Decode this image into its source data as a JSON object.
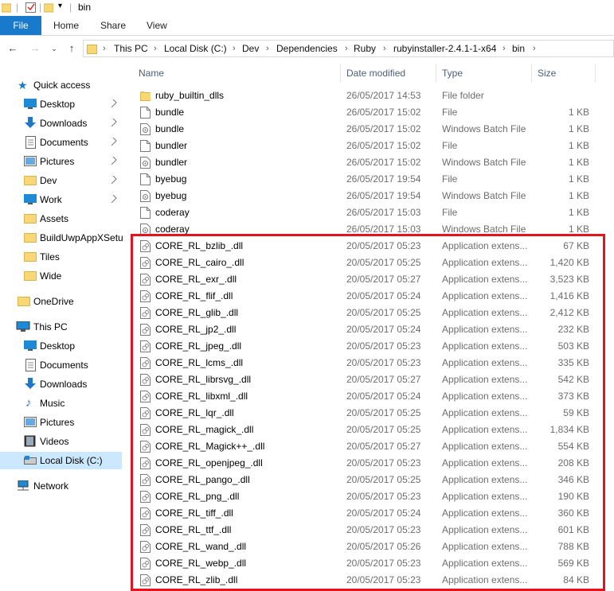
{
  "window": {
    "title": "bin"
  },
  "ribbon": {
    "tabs": [
      "File",
      "Home",
      "Share",
      "View"
    ]
  },
  "address": {
    "crumbs": [
      "This PC",
      "Local Disk (C:)",
      "Dev",
      "Dependencies",
      "Ruby",
      "rubyinstaller-2.4.1-1-x64",
      "bin"
    ]
  },
  "sidebar": {
    "quick_access": "Quick access",
    "quick_items": [
      "Desktop",
      "Downloads",
      "Documents",
      "Pictures",
      "Dev",
      "Work",
      "Assets",
      "BuildUwpAppXSetu",
      "Tiles",
      "Wide"
    ],
    "onedrive": "OneDrive",
    "this_pc": "This PC",
    "pc_items": [
      "Desktop",
      "Documents",
      "Downloads",
      "Music",
      "Pictures",
      "Videos",
      "Local Disk (C:)"
    ],
    "network": "Network"
  },
  "columns": {
    "name": "Name",
    "date": "Date modified",
    "type": "Type",
    "size": "Size"
  },
  "files": [
    {
      "name": "ruby_builtin_dlls",
      "date": "26/05/2017 14:53",
      "type": "File folder",
      "size": "",
      "icon": "folder-icon"
    },
    {
      "name": "bundle",
      "date": "26/05/2017 15:02",
      "type": "File",
      "size": "1 KB",
      "icon": "file-icon"
    },
    {
      "name": "bundle",
      "date": "26/05/2017 15:02",
      "type": "Windows Batch File",
      "size": "1 KB",
      "icon": "batch-file-icon"
    },
    {
      "name": "bundler",
      "date": "26/05/2017 15:02",
      "type": "File",
      "size": "1 KB",
      "icon": "file-icon"
    },
    {
      "name": "bundler",
      "date": "26/05/2017 15:02",
      "type": "Windows Batch File",
      "size": "1 KB",
      "icon": "batch-file-icon"
    },
    {
      "name": "byebug",
      "date": "26/05/2017 19:54",
      "type": "File",
      "size": "1 KB",
      "icon": "file-icon"
    },
    {
      "name": "byebug",
      "date": "26/05/2017 19:54",
      "type": "Windows Batch File",
      "size": "1 KB",
      "icon": "batch-file-icon"
    },
    {
      "name": "coderay",
      "date": "26/05/2017 15:03",
      "type": "File",
      "size": "1 KB",
      "icon": "file-icon"
    },
    {
      "name": "coderay",
      "date": "26/05/2017 15:03",
      "type": "Windows Batch File",
      "size": "1 KB",
      "icon": "batch-file-icon"
    },
    {
      "name": "CORE_RL_bzlib_.dll",
      "date": "20/05/2017 05:23",
      "type": "Application extens...",
      "size": "67 KB",
      "icon": "dll-icon"
    },
    {
      "name": "CORE_RL_cairo_.dll",
      "date": "20/05/2017 05:25",
      "type": "Application extens...",
      "size": "1,420 KB",
      "icon": "dll-icon"
    },
    {
      "name": "CORE_RL_exr_.dll",
      "date": "20/05/2017 05:27",
      "type": "Application extens...",
      "size": "3,523 KB",
      "icon": "dll-icon"
    },
    {
      "name": "CORE_RL_flif_.dll",
      "date": "20/05/2017 05:24",
      "type": "Application extens...",
      "size": "1,416 KB",
      "icon": "dll-icon"
    },
    {
      "name": "CORE_RL_glib_.dll",
      "date": "20/05/2017 05:25",
      "type": "Application extens...",
      "size": "2,412 KB",
      "icon": "dll-icon"
    },
    {
      "name": "CORE_RL_jp2_.dll",
      "date": "20/05/2017 05:24",
      "type": "Application extens...",
      "size": "232 KB",
      "icon": "dll-icon"
    },
    {
      "name": "CORE_RL_jpeg_.dll",
      "date": "20/05/2017 05:23",
      "type": "Application extens...",
      "size": "503 KB",
      "icon": "dll-icon"
    },
    {
      "name": "CORE_RL_lcms_.dll",
      "date": "20/05/2017 05:23",
      "type": "Application extens...",
      "size": "335 KB",
      "icon": "dll-icon"
    },
    {
      "name": "CORE_RL_librsvg_.dll",
      "date": "20/05/2017 05:27",
      "type": "Application extens...",
      "size": "542 KB",
      "icon": "dll-icon"
    },
    {
      "name": "CORE_RL_libxml_.dll",
      "date": "20/05/2017 05:24",
      "type": "Application extens...",
      "size": "373 KB",
      "icon": "dll-icon"
    },
    {
      "name": "CORE_RL_lqr_.dll",
      "date": "20/05/2017 05:25",
      "type": "Application extens...",
      "size": "59 KB",
      "icon": "dll-icon"
    },
    {
      "name": "CORE_RL_magick_.dll",
      "date": "20/05/2017 05:25",
      "type": "Application extens...",
      "size": "1,834 KB",
      "icon": "dll-icon"
    },
    {
      "name": "CORE_RL_Magick++_.dll",
      "date": "20/05/2017 05:27",
      "type": "Application extens...",
      "size": "554 KB",
      "icon": "dll-icon"
    },
    {
      "name": "CORE_RL_openjpeg_.dll",
      "date": "20/05/2017 05:23",
      "type": "Application extens...",
      "size": "208 KB",
      "icon": "dll-icon"
    },
    {
      "name": "CORE_RL_pango_.dll",
      "date": "20/05/2017 05:25",
      "type": "Application extens...",
      "size": "346 KB",
      "icon": "dll-icon"
    },
    {
      "name": "CORE_RL_png_.dll",
      "date": "20/05/2017 05:23",
      "type": "Application extens...",
      "size": "190 KB",
      "icon": "dll-icon"
    },
    {
      "name": "CORE_RL_tiff_.dll",
      "date": "20/05/2017 05:24",
      "type": "Application extens...",
      "size": "360 KB",
      "icon": "dll-icon"
    },
    {
      "name": "CORE_RL_ttf_.dll",
      "date": "20/05/2017 05:23",
      "type": "Application extens...",
      "size": "601 KB",
      "icon": "dll-icon"
    },
    {
      "name": "CORE_RL_wand_.dll",
      "date": "20/05/2017 05:26",
      "type": "Application extens...",
      "size": "788 KB",
      "icon": "dll-icon"
    },
    {
      "name": "CORE_RL_webp_.dll",
      "date": "20/05/2017 05:23",
      "type": "Application extens...",
      "size": "569 KB",
      "icon": "dll-icon"
    },
    {
      "name": "CORE_RL_zlib_.dll",
      "date": "20/05/2017 05:23",
      "type": "Application extens...",
      "size": "84 KB",
      "icon": "dll-icon"
    }
  ],
  "colors": {
    "accent": "#1979ca",
    "highlight_box": "#e3141f",
    "selected_nav": "#cce8ff"
  }
}
